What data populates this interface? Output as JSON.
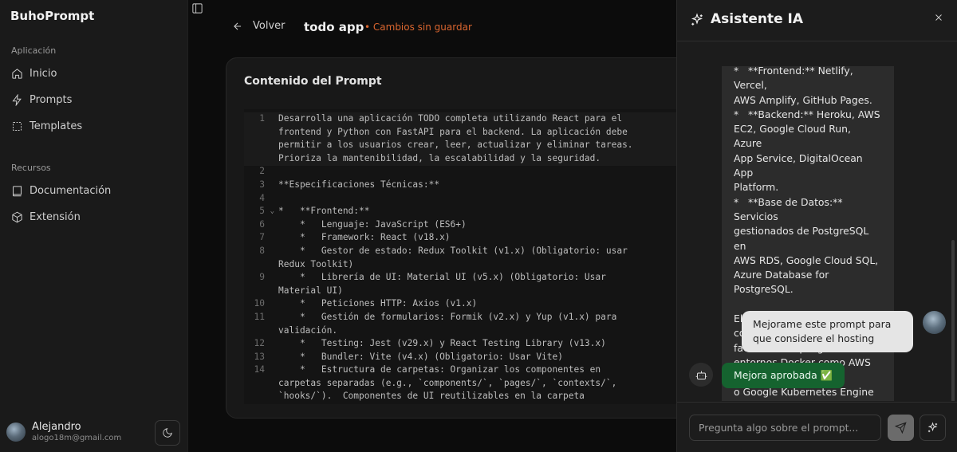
{
  "sidebar": {
    "brand": "BuhoPrompt",
    "sections": {
      "app_label": "Aplicación",
      "resources_label": "Recursos"
    },
    "items": [
      {
        "label": "Inicio",
        "icon": "home-icon"
      },
      {
        "label": "Prompts",
        "icon": "zap-icon"
      },
      {
        "label": "Templates",
        "icon": "template-icon"
      },
      {
        "label": "Documentación",
        "icon": "book-icon"
      },
      {
        "label": "Extensión",
        "icon": "cube-icon"
      }
    ],
    "user": {
      "name": "Alejandro",
      "email": "alogo18m@gmail.com"
    }
  },
  "header": {
    "back_label": "Volver",
    "title": "todo app",
    "unsaved": "• Cambios sin guardar"
  },
  "editor": {
    "card_title": "Contenido del Prompt",
    "line_numbers": [
      "1",
      "",
      "",
      "",
      "2",
      "3",
      "4",
      "5",
      "6",
      "7",
      "8",
      "",
      "9",
      "",
      "10",
      "11",
      "",
      "12",
      "13",
      "14",
      "",
      ""
    ],
    "code": "Desarrolla una aplicación TODO completa utilizando React para el\nfrontend y Python con FastAPI para el backend. La aplicación debe\npermitir a los usuarios crear, leer, actualizar y eliminar tareas.\nPrioriza la mantenibilidad, la escalabilidad y la seguridad.\n\n**Especificaciones Técnicas:**\n\n*   **Frontend:**\n    *   Lenguaje: JavaScript (ES6+)\n    *   Framework: React (v18.x)\n    *   Gestor de estado: Redux Toolkit (v1.x) (Obligatorio: usar\nRedux Toolkit)\n    *   Librería de UI: Material UI (v5.x) (Obligatorio: Usar\nMaterial UI)\n    *   Peticiones HTTP: Axios (v1.x)\n    *   Gestión de formularios: Formik (v2.x) y Yup (v1.x) para\nvalidación.\n    *   Testing: Jest (v29.x) y React Testing Library (v13.x)\n    *   Bundler: Vite (v4.x) (Obligatorio: Usar Vite)\n    *   Estructura de carpetas: Organizar los componentes en\ncarpetas separadas (e.g., `components/`, `pages/`, `contexts/`,\n`hooks/`).  Componentes de UI reutilizables en la carpeta"
  },
  "assistant": {
    "title": "Asistente IA",
    "messages": {
      "ai_text": "*   **Frontend:** Netlify, Vercel,\nAWS Amplify, GitHub Pages.\n*   **Backend:** Heroku, AWS\nEC2, Google Cloud Run, Azure\nApp Service, DigitalOcean App\nPlatform.\n*   **Base de Datos:** Servicios\ngestionados de PostgreSQL en\nAWS RDS, Google Cloud SQL,\nAzure Database for PostgreSQL.\n\nEl archivo `docker-compose.yml`\nfacilita el despliegue en\nentornos Docker como AWS ECS\no Google Kubernetes Engine\n(GKE).",
      "user_text": "Mejorame este prompt para que considere el hosting",
      "approved_text": "Mejora aprobada ✅"
    },
    "input_placeholder": "Pregunta algo sobre el prompt..."
  },
  "colors": {
    "accent_unsaved": "#d9652f",
    "approved_green": "#15632f"
  }
}
